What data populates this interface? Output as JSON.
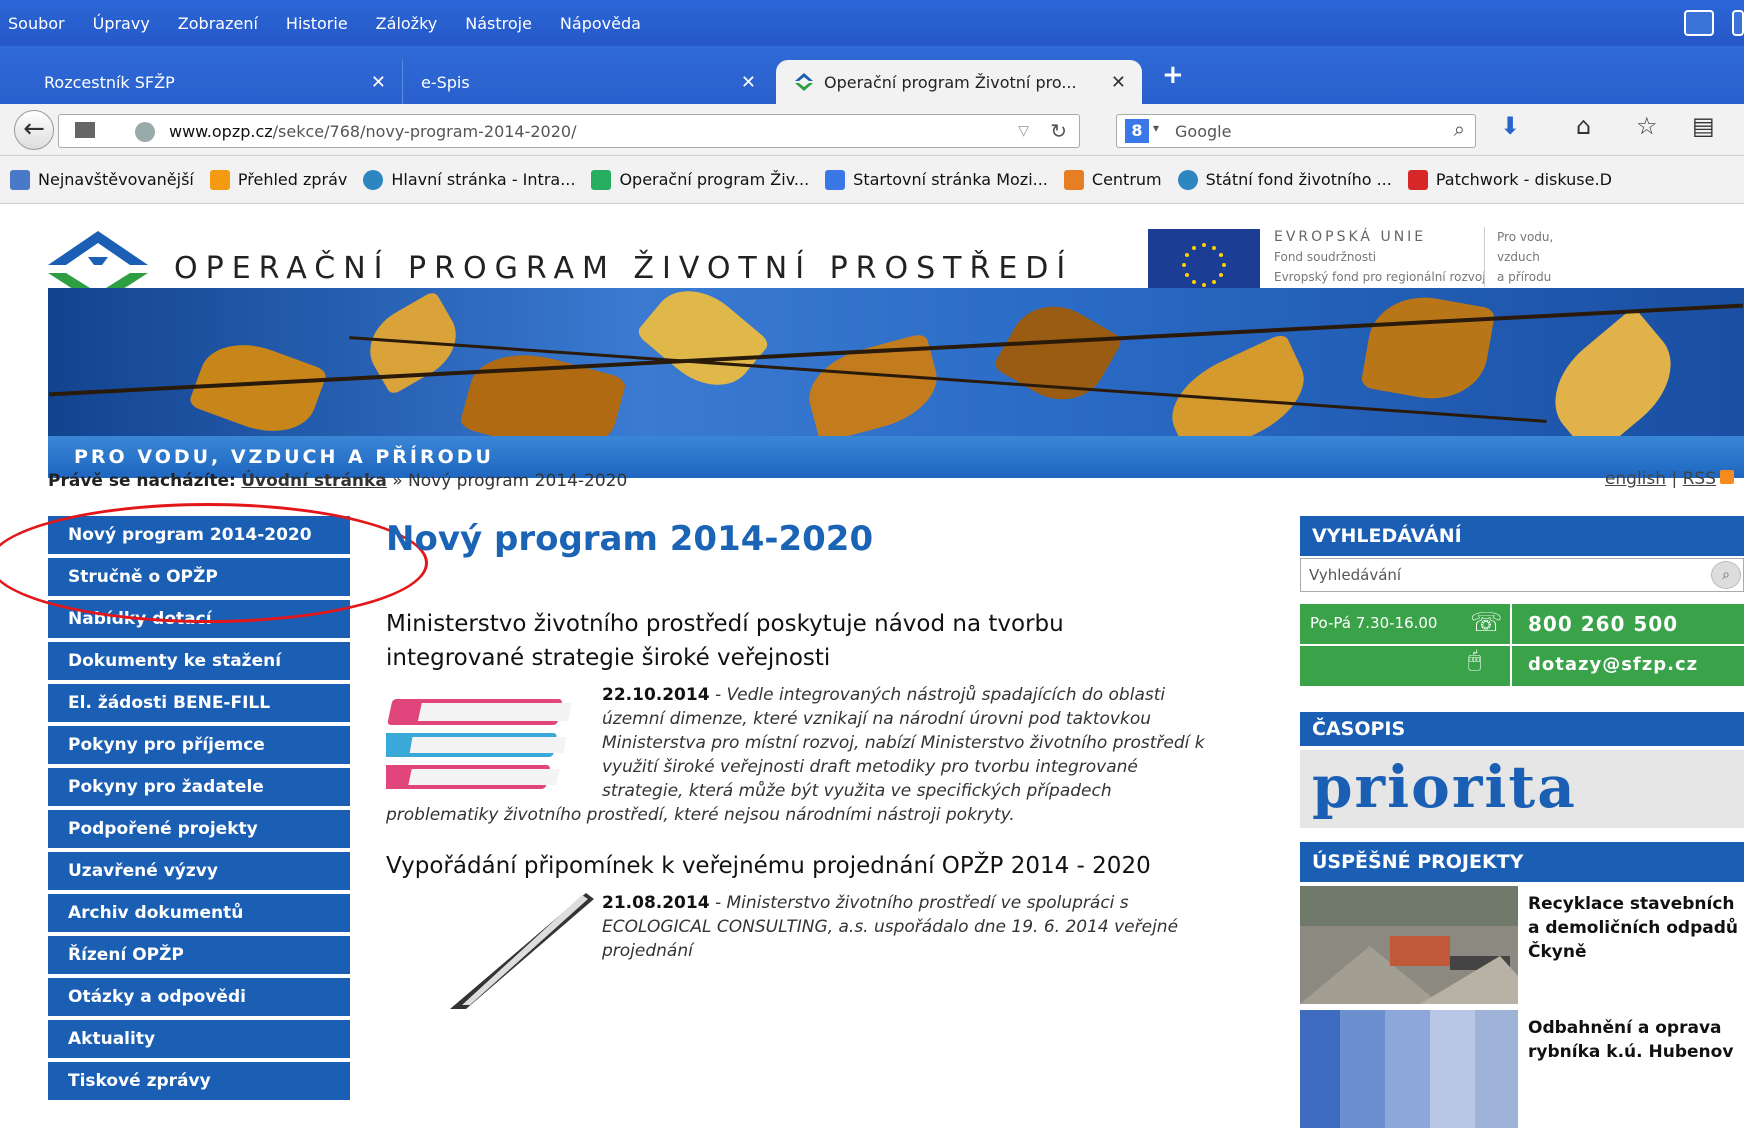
{
  "browser": {
    "menu": [
      "Soubor",
      "Úpravy",
      "Zobrazení",
      "Historie",
      "Záložky",
      "Nástroje",
      "Nápověda"
    ],
    "tabs": [
      {
        "label": "Rozcestník SFŽP"
      },
      {
        "label": "e-Spis"
      },
      {
        "label": "Operační program Životní pro..."
      }
    ],
    "newtab": "+",
    "url": {
      "host": "www.opzp.cz",
      "path": "/sekce/768/novy-program-2014-2020/"
    },
    "search_placeholder": "Google",
    "bookmarks": [
      {
        "label": "Nejnavštěvovanější",
        "color": "#4a78c8"
      },
      {
        "label": "Přehled zpráv",
        "color": "#f39c12"
      },
      {
        "label": "Hlavní stránka - Intra...",
        "color": "#2e86c1"
      },
      {
        "label": "Operační program Živ...",
        "color": "#27ae60"
      },
      {
        "label": "Startovní stránka Mozi...",
        "color": "#3b78e7"
      },
      {
        "label": "Centrum",
        "color": "#e67e22"
      },
      {
        "label": "Státní fond životního ...",
        "color": "#2e86c1"
      },
      {
        "label": "Patchwork - diskuse.D",
        "color": "#d62828"
      }
    ]
  },
  "site": {
    "title": "OPERAČNÍ PROGRAM ŽIVOTNÍ PROSTŘEDÍ",
    "eu": {
      "line1": "EVROPSKÁ UNIE",
      "line2": "Fond soudržnosti",
      "line3": "Evropský fond pro regionální rozvoj"
    },
    "slogan": [
      "Pro vodu,",
      "vzduch",
      "a přírodu"
    ],
    "strip": "PRO VODU, VZDUCH A PŘÍRODU"
  },
  "breadcrumb": {
    "prefix": "Právě se nacházíte:",
    "home": "Úvodní stránka",
    "sep": "»",
    "current": "Nový program 2014-2020"
  },
  "lang": {
    "english": "english",
    "sep": "|",
    "rss": "RSS"
  },
  "leftmenu": [
    "Nový program 2014-2020",
    "Stručně o OPŽP",
    "Nabídky dotací",
    "Dokumenty ke stažení",
    "El. žádosti BENE-FILL",
    "Pokyny pro příjemce",
    "Pokyny pro žadatele",
    "Podpořené projekty",
    "Uzavřené výzvy",
    "Archiv dokumentů",
    "Řízení OPŽP",
    "Otázky a odpovědi",
    "Aktuality",
    "Tiskové zprávy"
  ],
  "main": {
    "heading": "Nový program 2014-2020",
    "articles": [
      {
        "title": "Ministerstvo životního prostředí poskytuje návod na tvorbu integrované strategie široké veřejnosti",
        "date": "22.10.2014",
        "sep": " - ",
        "text": "Vedle integrovaných nástrojů spadajících do oblasti územní dimenze, které vznikají na národní úrovni pod taktovkou Ministerstva pro místní rozvoj, nabízí Ministerstvo životního prostředí k využití široké veřejnosti draft metodiky pro tvorbu integrované strategie, která může být využita ve specifických případech problematiky životního prostředí, které nejsou národními nástroji pokryty."
      },
      {
        "title": "Vypořádání připomínek k veřejnému projednání OPŽP 2014 - 2020",
        "date": "21.08.2014",
        "sep": " - ",
        "text": "Ministerstvo životního prostředí ve spolupráci s ECOLOGICAL CONSULTING, a.s. uspořádalo dne 19. 6. 2014 veřejné projednání"
      }
    ]
  },
  "right": {
    "search_head": "VYHLEDÁVÁNÍ",
    "search_placeholder": "Vyhledávání",
    "hours": "Po-Pá 7.30-16.00",
    "phone": "800 260 500",
    "email": "dotazy@sfzp.cz",
    "magazine_head": "ČASOPIS",
    "magazine_name": "priorita",
    "projects_head": "ÚSPĚŠNÉ PROJEKTY",
    "projects": [
      "Recyklace stavebních a demoličních odpadů Čkyně",
      "Odbahnění a oprava rybníka k.ú. Hubenov"
    ]
  }
}
